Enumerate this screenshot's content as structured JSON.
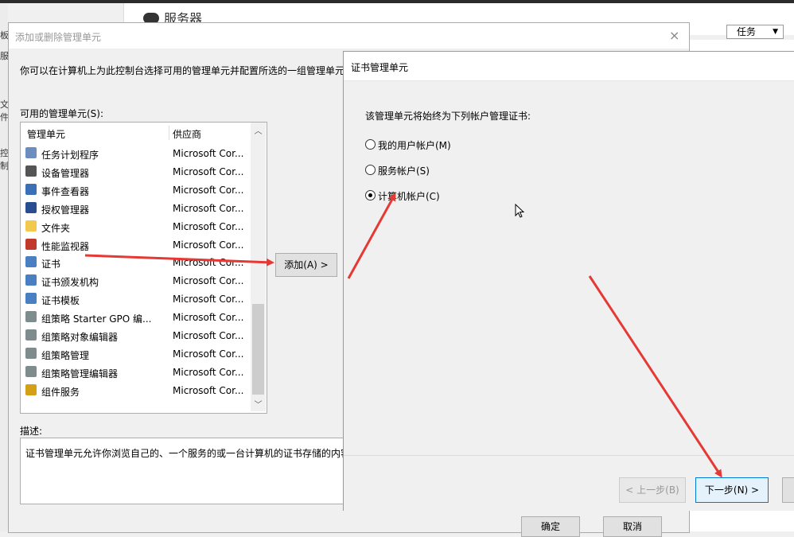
{
  "background": {
    "window_title": "服务器",
    "tasks_label": "任务",
    "tasks_arrow": "▼",
    "left_fragments": [
      "板",
      "服",
      "",
      "文件",
      "",
      "控制",
      "",
      "",
      ""
    ]
  },
  "main_dialog": {
    "title": "添加或删除管理单元",
    "close_glyph": "×",
    "intro": "你可以在计算机上为此控制台选择可用的管理单元并配置所选的一组管理单元。",
    "available_label": "可用的管理单元(S):",
    "columns": {
      "name": "管理单元",
      "vendor": "供应商"
    },
    "items": [
      {
        "name": "任务计划程序",
        "vendor": "Microsoft Cor...",
        "icon": "clock-icon",
        "color": "#6c8ebf"
      },
      {
        "name": "设备管理器",
        "vendor": "Microsoft Cor...",
        "icon": "device-manager-icon",
        "color": "#555555"
      },
      {
        "name": "事件查看器",
        "vendor": "Microsoft Cor...",
        "icon": "event-viewer-icon",
        "color": "#3b6fb6"
      },
      {
        "name": "授权管理器",
        "vendor": "Microsoft Cor...",
        "icon": "authorization-manager-icon",
        "color": "#2a4d8f"
      },
      {
        "name": "文件夹",
        "vendor": "Microsoft Cor...",
        "icon": "folder-icon",
        "color": "#f2c94c"
      },
      {
        "name": "性能监视器",
        "vendor": "Microsoft Cor...",
        "icon": "performance-monitor-icon",
        "color": "#c0392b"
      },
      {
        "name": "证书",
        "vendor": "Microsoft Cor...",
        "icon": "certificate-icon",
        "color": "#4a7fc1"
      },
      {
        "name": "证书颁发机构",
        "vendor": "Microsoft Cor...",
        "icon": "certification-authority-icon",
        "color": "#4a7fc1"
      },
      {
        "name": "证书模板",
        "vendor": "Microsoft Cor...",
        "icon": "certificate-template-icon",
        "color": "#4a7fc1"
      },
      {
        "name": "组策略 Starter GPO 编...",
        "vendor": "Microsoft Cor...",
        "icon": "group-policy-icon",
        "color": "#7f8c8d"
      },
      {
        "name": "组策略对象编辑器",
        "vendor": "Microsoft Cor...",
        "icon": "group-policy-icon",
        "color": "#7f8c8d"
      },
      {
        "name": "组策略管理",
        "vendor": "Microsoft Cor...",
        "icon": "group-policy-management-icon",
        "color": "#7f8c8d"
      },
      {
        "name": "组策略管理编辑器",
        "vendor": "Microsoft Cor...",
        "icon": "group-policy-icon",
        "color": "#7f8c8d"
      },
      {
        "name": "组件服务",
        "vendor": "Microsoft Cor...",
        "icon": "component-services-icon",
        "color": "#d4a017"
      }
    ],
    "add_button": "添加(A) >",
    "description_label": "描述:",
    "description_text": "证书管理单元允许你浏览自己的、一个服务的或一台计算机的证书存储的内容。",
    "ok_button": "确定",
    "cancel_button": "取消"
  },
  "cert_dialog": {
    "title": "证书管理单元",
    "prompt": "该管理单元将始终为下列帐户管理证书:",
    "options": [
      {
        "label": "我的用户帐户(M)",
        "selected": false
      },
      {
        "label": "服务帐户(S)",
        "selected": false
      },
      {
        "label": "计算机帐户(C)",
        "selected": true
      }
    ],
    "back_button": "< 上一步(B)",
    "next_button": "下一步(N) >"
  },
  "annotation_color": "#e53935"
}
